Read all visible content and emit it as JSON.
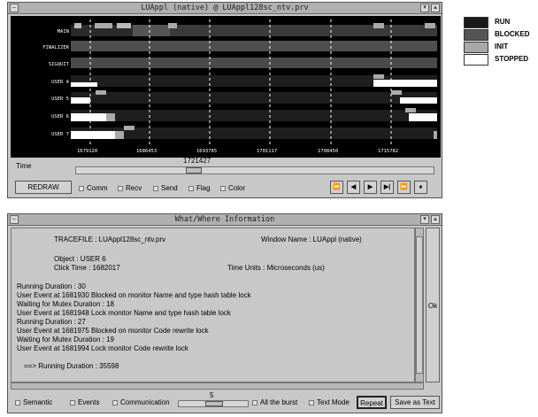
{
  "trace_window": {
    "title": "LUAppl (native) @ LUAppl128sc_ntv.prv",
    "rows": [
      "MAIN",
      "FINALIZER",
      "SIGQUIT",
      "USER 4",
      "USER 5",
      "USER 6",
      "USER 7"
    ],
    "ticks": [
      "1679120",
      "1686453",
      "1693785",
      "1701117",
      "1708450",
      "1715782"
    ],
    "time_label": "Time",
    "time_value": "1721427",
    "redraw_label": "REDRAW",
    "checkboxes": [
      "Comm",
      "Recv",
      "Send",
      "Flag",
      "Color"
    ],
    "nav": [
      "⏪",
      "◀",
      "▶",
      "▶|",
      "⏩",
      "⏸"
    ]
  },
  "legend": [
    {
      "label": "RUN",
      "color": "#1a1a1a"
    },
    {
      "label": "BLOCKED",
      "color": "#555555"
    },
    {
      "label": "INIT",
      "color": "#a8a8a8"
    },
    {
      "label": "STOPPED",
      "color": "#ffffff"
    }
  ],
  "info_window": {
    "title": "What/Where Information",
    "tracefile": "TRACEFILE : LUAppl128sc_ntv.prv",
    "window_name": "Window Name : LUAppl (native)",
    "object": "Object : USER 6",
    "click_time": "Click Time : 1682017",
    "time_units": "Time Units : Microseconds (us)",
    "lines": [
      "Running    Duration : 30",
      "User Event at 1681930    Blocked on monitor Name and type hash table lock",
      "Waiting for Mutex    Duration : 18",
      "User Event at 1681948    Lock monitor Name and type hash table lock",
      "Running    Duration : 27",
      "User Event at 1681975    Blocked on monitor Code rewrite lock",
      "Waiting for Mutex    Duration : 19",
      "User Event at 1681994    Lock monitor Code rewrite lock"
    ],
    "final_line": "==> Running    Duration : 35598",
    "ok_label": "Ok",
    "checks": [
      "Semantic",
      "Events",
      "Communication"
    ],
    "burst_value": "5",
    "all_burst": "All the burst",
    "text_mode": "Text Mode",
    "repeat": "Repeat",
    "save": "Save as Text"
  }
}
